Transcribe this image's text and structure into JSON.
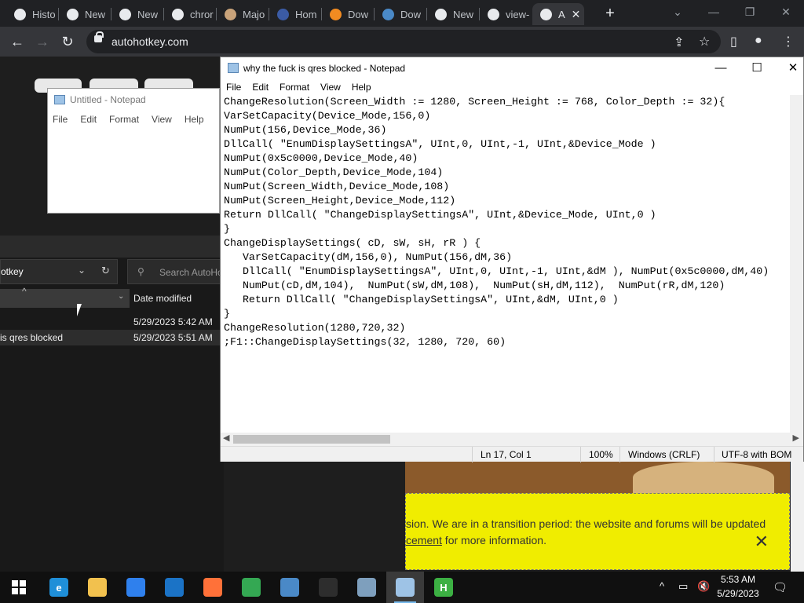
{
  "browser": {
    "tabs": [
      {
        "label": "Histo",
        "icon": "history-icon",
        "color": "#e8eaed"
      },
      {
        "label": "New",
        "icon": "chrome-icon",
        "color": "#e8eaed"
      },
      {
        "label": "New",
        "icon": "chrome-icon",
        "color": "#e8eaed"
      },
      {
        "label": "chror",
        "icon": "chrome-icon",
        "color": "#e8eaed"
      },
      {
        "label": "Majo",
        "icon": "avatar-icon",
        "color": "#c9a37a"
      },
      {
        "label": "Hom",
        "icon": "site-icon",
        "color": "#3b5ba5"
      },
      {
        "label": "Dow",
        "icon": "site-icon",
        "color": "#f28b21"
      },
      {
        "label": "Dow",
        "icon": "python-icon",
        "color": "#4a89c7"
      },
      {
        "label": "New",
        "icon": "chrome-icon",
        "color": "#e8eaed"
      },
      {
        "label": "view-",
        "icon": "chrome-icon",
        "color": "#e8eaed"
      },
      {
        "label": "A",
        "icon": "autohotkey-icon",
        "color": "#e8eaed"
      }
    ],
    "url": "autohotkey.com"
  },
  "notepad_back": {
    "title": "Untitled - Notepad",
    "menu": [
      "File",
      "Edit",
      "Format",
      "View",
      "Help"
    ]
  },
  "explorer": {
    "address": "otkey",
    "search_placeholder": "Search AutoHo",
    "date_header": "Date modified",
    "files": [
      {
        "name": "",
        "date": "5/29/2023 5:42 AM"
      },
      {
        "name": "is qres blocked",
        "date": "5/29/2023 5:51 AM"
      }
    ]
  },
  "notepad": {
    "title": "why the fuck is qres blocked - Notepad",
    "menu": [
      "File",
      "Edit",
      "Format",
      "View",
      "Help"
    ],
    "lines": [
      "ChangeResolution(Screen_Width := 1280, Screen_Height := 768, Color_Depth := 32){",
      "VarSetCapacity(Device_Mode,156,0)",
      "NumPut(156,Device_Mode,36)",
      "DllCall( \"EnumDisplaySettingsA\", UInt,0, UInt,-1, UInt,&Device_Mode )",
      "NumPut(0x5c0000,Device_Mode,40)",
      "NumPut(Color_Depth,Device_Mode,104)",
      "NumPut(Screen_Width,Device_Mode,108)",
      "NumPut(Screen_Height,Device_Mode,112)",
      "Return DllCall( \"ChangeDisplaySettingsA\", UInt,&Device_Mode, UInt,0 )",
      "}",
      "ChangeDisplaySettings( cD, sW, sH, rR ) {",
      "   VarSetCapacity(dM,156,0), NumPut(156,dM,36)",
      "   DllCall( \"EnumDisplaySettingsA\", UInt,0, UInt,-1, UInt,&dM ), NumPut(0x5c0000,dM,40)",
      "   NumPut(cD,dM,104),  NumPut(sW,dM,108),  NumPut(sH,dM,112),  NumPut(rR,dM,120)",
      "   Return DllCall( \"ChangeDisplaySettingsA\", UInt,&dM, UInt,0 )",
      "}",
      "",
      "ChangeResolution(1280,720,32)",
      ";F1::ChangeDisplaySettings(32, 1280, 720, 60)"
    ],
    "status": {
      "position": "Ln 17, Col 1",
      "zoom": "100%",
      "line_ending": "Windows (CRLF)",
      "encoding": "UTF-8 with BOM"
    }
  },
  "banner": {
    "line1": "sion. We are in a transition period: the website and forums will be updated",
    "link": "cement",
    "line2_rest": " for more information."
  },
  "taskbar": {
    "apps": [
      {
        "name": "edge",
        "glyph": "e",
        "color": "#1f8fd8"
      },
      {
        "name": "file-explorer",
        "glyph": "",
        "color": "#f2c14e"
      },
      {
        "name": "store",
        "glyph": "",
        "color": "#2f80ed"
      },
      {
        "name": "mail",
        "glyph": "",
        "color": "#1b73c6"
      },
      {
        "name": "firefox",
        "glyph": "",
        "color": "#ff7139"
      },
      {
        "name": "chrome",
        "glyph": "",
        "color": "#34a853"
      },
      {
        "name": "python",
        "glyph": "",
        "color": "#4a89c7"
      },
      {
        "name": "terminal",
        "glyph": "",
        "color": "#2d2d2d"
      },
      {
        "name": "control-panel",
        "glyph": "",
        "color": "#7e9fbd"
      },
      {
        "name": "notepad",
        "glyph": "",
        "color": "#9ec3e6"
      },
      {
        "name": "autohotkey",
        "glyph": "H",
        "color": "#3cb043"
      }
    ],
    "time": "5:53 AM",
    "date": "5/29/2023"
  }
}
